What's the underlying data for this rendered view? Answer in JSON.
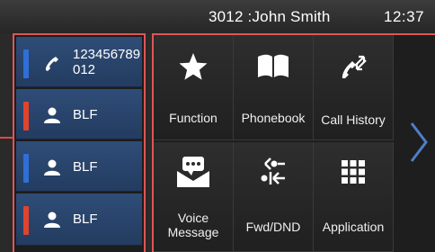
{
  "statusbar": {
    "account": "3012 :John Smith",
    "time": "12:37"
  },
  "line_keys": [
    {
      "type": "handset",
      "label": "123456789\n012",
      "indicator_color": "#2f6fd6",
      "icon": "handset-icon"
    },
    {
      "type": "blf",
      "label": "BLF",
      "indicator_color": "#e0442e",
      "icon": "user-icon"
    },
    {
      "type": "blf",
      "label": "BLF",
      "indicator_color": "#2f6fd6",
      "icon": "user-icon"
    },
    {
      "type": "blf",
      "label": "BLF",
      "indicator_color": "#e0442e",
      "icon": "user-icon"
    }
  ],
  "functions": [
    {
      "label": "Function",
      "icon": "star-icon"
    },
    {
      "label": "Phonebook",
      "icon": "book-icon"
    },
    {
      "label": "Call History",
      "icon": "call-history-icon"
    },
    {
      "label": "Voice\nMessage",
      "icon": "voicemail-icon"
    },
    {
      "label": "Fwd/DND",
      "icon": "forward-dnd-icon"
    },
    {
      "label": "Application",
      "icon": "grid-icon"
    }
  ],
  "next_page_icon": "chevron-right-icon",
  "colors": {
    "accent_blue": "#2f6fd6",
    "accent_red": "#e0442e",
    "selection_border": "#e05555"
  }
}
